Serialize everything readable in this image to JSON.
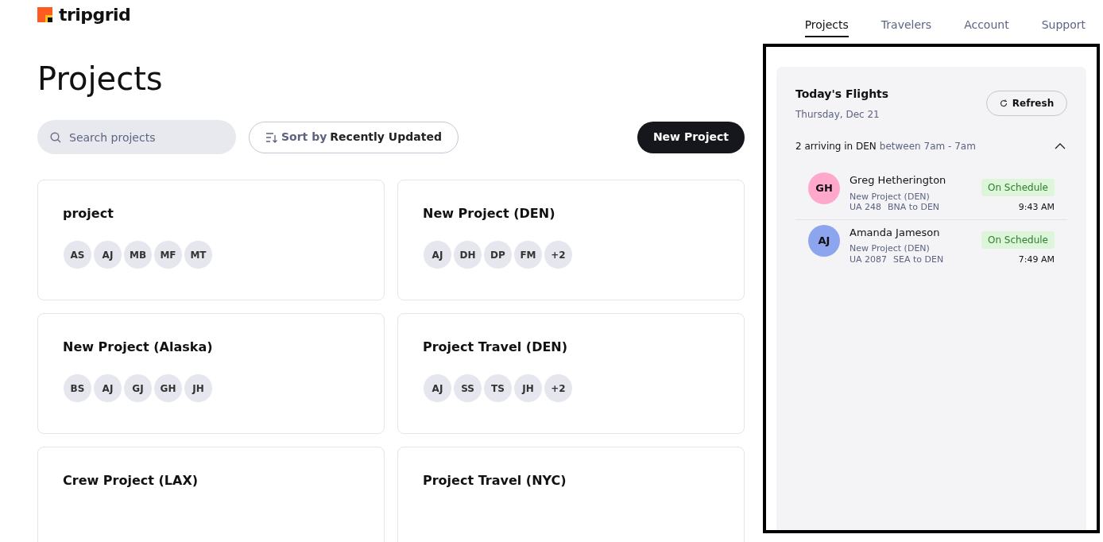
{
  "brand": {
    "name": "tripgrid"
  },
  "nav": [
    {
      "label": "Projects",
      "selected": true
    },
    {
      "label": "Travelers",
      "selected": false
    },
    {
      "label": "Account",
      "selected": false
    },
    {
      "label": "Support",
      "selected": false
    }
  ],
  "page_title": "Projects",
  "search": {
    "placeholder": "Search projects"
  },
  "sort": {
    "prefix": "Sort by",
    "value": "Recently Updated"
  },
  "new_button": "New Project",
  "projects": [
    {
      "name": "project",
      "members": [
        "AS",
        "AJ",
        "MB",
        "MF",
        "MT"
      ]
    },
    {
      "name": "New Project (DEN)",
      "members": [
        "AJ",
        "DH",
        "DP",
        "FM",
        "+2"
      ]
    },
    {
      "name": "New Project (Alaska)",
      "members": [
        "BS",
        "AJ",
        "GJ",
        "GH",
        "JH"
      ]
    },
    {
      "name": "Project Travel (DEN)",
      "members": [
        "AJ",
        "SS",
        "TS",
        "JH",
        "+2"
      ]
    },
    {
      "name": "Crew Project (LAX)"
    },
    {
      "name": "Project Travel (NYC)"
    }
  ],
  "flights_panel": {
    "title": "Today's Flights",
    "date": "Thursday, Dec 21",
    "refresh": "Refresh",
    "group": {
      "label": "2 arriving in DEN",
      "range": "between 7am - 7am",
      "expanded": true,
      "flights": [
        {
          "initials": "GH",
          "color": "#ffa8cc",
          "name": "Greg Hetherington",
          "project": "New Project (DEN)",
          "flight": "UA 248",
          "route": "BNA to DEN",
          "status": "On Schedule",
          "time": "9:43 AM"
        },
        {
          "initials": "AJ",
          "color": "#8da4ef",
          "name": "Amanda Jameson",
          "project": "New Project (DEN)",
          "flight": "UA 2087",
          "route": "SEA to DEN",
          "status": "On Schedule",
          "time": "7:49 AM"
        }
      ]
    }
  }
}
